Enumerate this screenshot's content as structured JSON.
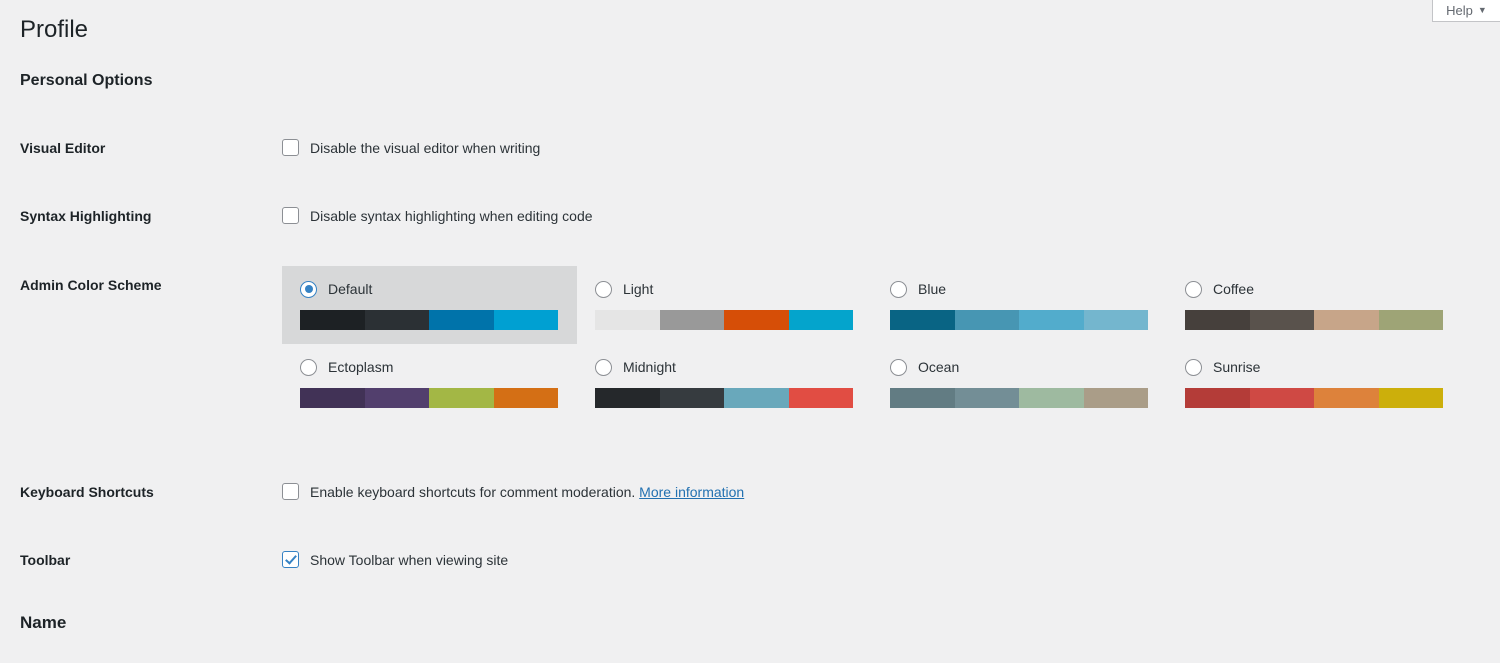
{
  "help_tab": {
    "label": "Help",
    "caret_icon": "chevron-down-icon"
  },
  "page_title": "Profile",
  "sections": {
    "personal_options": "Personal Options",
    "name": "Name"
  },
  "rows": {
    "visual_editor": {
      "label": "Visual Editor",
      "checkbox_label": "Disable the visual editor when writing",
      "checked": false
    },
    "syntax_highlighting": {
      "label": "Syntax Highlighting",
      "checkbox_label": "Disable syntax highlighting when editing code",
      "checked": false
    },
    "admin_color_scheme": {
      "label": "Admin Color Scheme"
    },
    "keyboard_shortcuts": {
      "label": "Keyboard Shortcuts",
      "checkbox_label": "Enable keyboard shortcuts for comment moderation.",
      "link_label": "More information",
      "checked": false
    },
    "toolbar": {
      "label": "Toolbar",
      "checkbox_label": "Show Toolbar when viewing site",
      "checked": true
    }
  },
  "color_schemes": [
    {
      "name": "Default",
      "selected": true,
      "colors": [
        "#1d2124",
        "#2b3034",
        "#0073aa",
        "#00a0d2"
      ]
    },
    {
      "name": "Light",
      "selected": false,
      "colors": [
        "#e5e5e5",
        "#999999",
        "#d64e07",
        "#04a4cc"
      ]
    },
    {
      "name": "Blue",
      "selected": false,
      "colors": [
        "#096484",
        "#4796b3",
        "#52accc",
        "#74b6ce"
      ]
    },
    {
      "name": "Coffee",
      "selected": false,
      "colors": [
        "#46403c",
        "#59524c",
        "#c7a589",
        "#9ea476"
      ]
    },
    {
      "name": "Ectoplasm",
      "selected": false,
      "colors": [
        "#413256",
        "#523f6d",
        "#a3b745",
        "#d46f15"
      ]
    },
    {
      "name": "Midnight",
      "selected": false,
      "colors": [
        "#25282b",
        "#363b3f",
        "#69a8bb",
        "#e14d43"
      ]
    },
    {
      "name": "Ocean",
      "selected": false,
      "colors": [
        "#627c83",
        "#738e96",
        "#9ebaa0",
        "#aa9d88"
      ]
    },
    {
      "name": "Sunrise",
      "selected": false,
      "colors": [
        "#b43c38",
        "#cf4944",
        "#dd823b",
        "#ccaf0b"
      ]
    }
  ]
}
